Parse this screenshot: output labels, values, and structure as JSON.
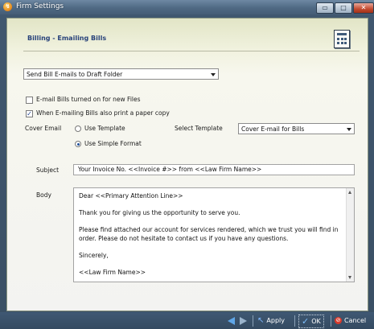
{
  "window": {
    "title": "Firm Settings",
    "controls": {
      "minimize": "▭",
      "maximize": "□",
      "close": "✕"
    }
  },
  "header": {
    "title": "Billing - Emailing Bills",
    "icon": "calculator-icon"
  },
  "email_mode": {
    "selected": "Send Bill E-mails to Draft Folder"
  },
  "options": {
    "email_bills_new_files": {
      "label": "E-mail Bills turned on for new Files",
      "checked": false
    },
    "print_paper_copy": {
      "label": "When E-mailing Bills also print a paper copy",
      "checked": true
    }
  },
  "cover_email": {
    "label": "Cover Email",
    "use_template": {
      "label": "Use Template",
      "selected": false
    },
    "use_simple_format": {
      "label": "Use Simple Format",
      "selected": true
    },
    "select_template_label": "Select Template",
    "template_selected": "Cover E-mail for Bills"
  },
  "subject": {
    "label": "Subject",
    "value": "Your Invoice No. <<Invoice #>> from <<Law Firm Name>>"
  },
  "body": {
    "label": "Body",
    "lines": [
      "Dear <<Primary Attention Line>>",
      "Thank you for giving us the opportunity to serve you.",
      "Please find attached our account for services rendered, which we trust you will find in",
      "order. Please do not hesitate to contact us if you have any questions.",
      "Sincerely,",
      "<<Law Firm Name>>"
    ]
  },
  "footer": {
    "apply": "Apply",
    "ok": "OK",
    "cancel": "Cancel"
  },
  "colors": {
    "accent": "#28427a",
    "panel": "#f3f3f1",
    "chrome": "#3a4f64"
  }
}
